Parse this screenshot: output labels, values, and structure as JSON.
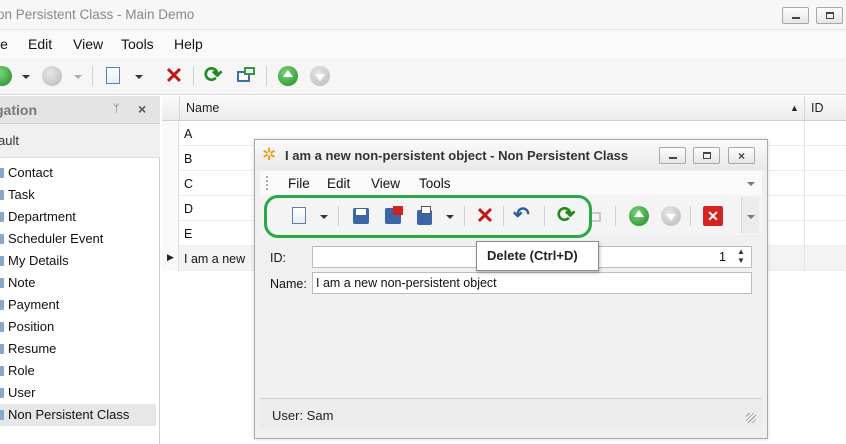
{
  "window": {
    "title": "on Persistent Class - Main Demo"
  },
  "menu": [
    "le",
    "Edit",
    "View",
    "Tools",
    "Help"
  ],
  "navigation": {
    "header": "gation",
    "group": "ault",
    "items": [
      "Contact",
      "Task",
      "Department",
      "Scheduler Event",
      "My Details",
      "Note",
      "Payment",
      "Position",
      "Resume",
      "Role",
      "User",
      "Non Persistent Class"
    ],
    "selected": "Non Persistent Class"
  },
  "grid": {
    "columns": [
      "Name",
      "ID"
    ],
    "rows": [
      "A",
      "B",
      "C",
      "D",
      "E",
      "I am a new"
    ]
  },
  "dialog": {
    "title": "I am a new non-persistent object - Non Persistent Class",
    "menu": [
      "File",
      "Edit",
      "View",
      "Tools"
    ],
    "id_label": "ID:",
    "id_value": "1",
    "name_label": "Name:",
    "name_value": "I am a new non-persistent object",
    "tooltip": "Delete (Ctrl+D)",
    "status": "User: Sam"
  },
  "colors": {
    "highlight": "#29a847",
    "delete": "#c41414",
    "refresh": "#1f8a1f"
  }
}
